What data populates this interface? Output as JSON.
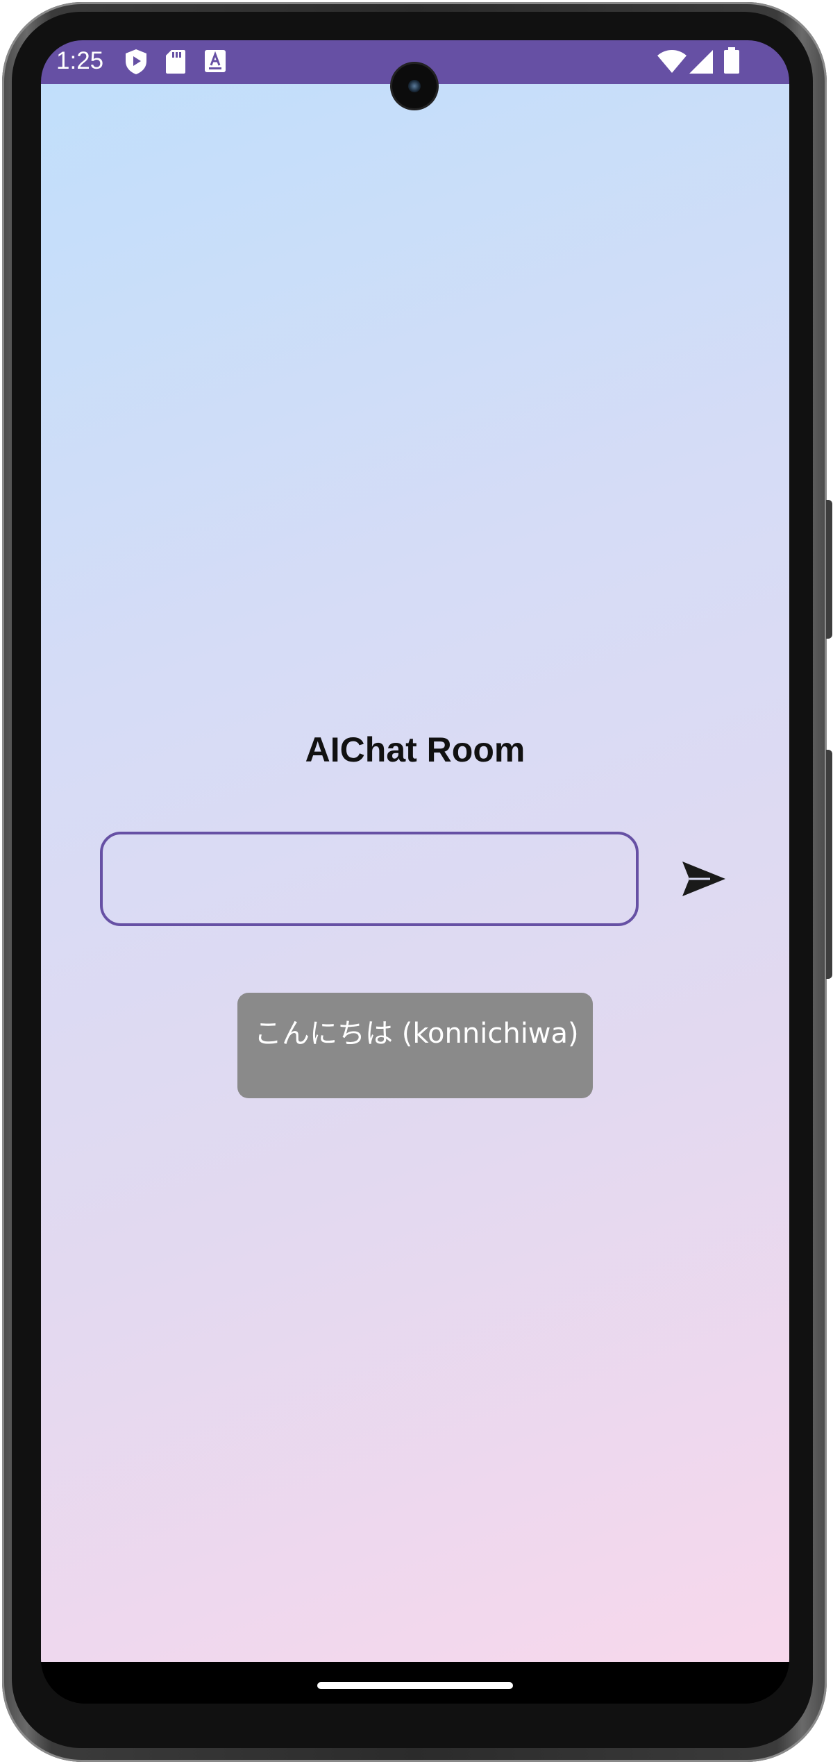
{
  "statusbar": {
    "time": "1:25",
    "left_icons": [
      "shield-play-icon",
      "sd-card-icon",
      "keyboard-a-icon"
    ],
    "right_icons": [
      "wifi-icon",
      "cell-signal-icon",
      "battery-icon"
    ],
    "color": "#6650a4"
  },
  "app": {
    "title": "AIChat Room",
    "input": {
      "value": "",
      "placeholder": ""
    },
    "send_icon": "send-icon",
    "messages": [
      {
        "text": "こんにちは (konnichiwa)"
      }
    ]
  },
  "colors": {
    "accent": "#6650a4",
    "bubble": "#8a8a8a",
    "gradient_start": "#c1dffb",
    "gradient_end": "#f7d8ec"
  }
}
